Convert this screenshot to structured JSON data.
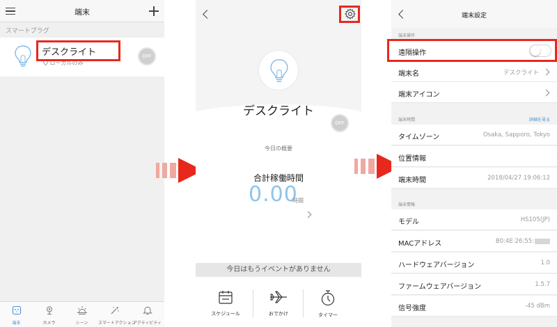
{
  "panel1": {
    "title": "端末",
    "section": "スマートプラグ",
    "device": {
      "name": "デスクライト",
      "subtitle": "ローカルのみ",
      "toggle": "OFF"
    },
    "tabs": [
      {
        "label": "端末",
        "icon": "plug-icon",
        "active": true
      },
      {
        "label": "カメラ",
        "icon": "camera-icon",
        "active": false
      },
      {
        "label": "シーン",
        "icon": "sunrise-icon",
        "active": false
      },
      {
        "label": "スマートアクション",
        "icon": "magic-wand-icon",
        "active": false
      },
      {
        "label": "アクティビティ",
        "icon": "bell-icon",
        "active": false
      }
    ]
  },
  "panel2": {
    "device_name": "デスクライト",
    "toggle": "OFF",
    "summary_label": "今日の概要",
    "total_label": "合計稼働時間",
    "total_value": "0.00",
    "total_unit": "時間",
    "no_events": "今日はもうイベントがありません",
    "actions": [
      {
        "label": "スケジュール",
        "icon": "calendar-icon"
      },
      {
        "label": "おでかけ",
        "icon": "airplane-icon"
      },
      {
        "label": "タイマー",
        "icon": "stopwatch-icon"
      }
    ]
  },
  "panel3": {
    "title": "端末設定",
    "sections": [
      {
        "header": "端末操作"
      },
      {
        "header": "端末時間",
        "link": "詳細を見る"
      },
      {
        "header": "端末情報"
      }
    ],
    "rows": {
      "remote": {
        "label": "遠隔操作",
        "toggle_on": false
      },
      "name": {
        "label": "端末名",
        "value": "デスクライト"
      },
      "icon": {
        "label": "端末アイコン"
      },
      "timezone": {
        "label": "タイムゾーン",
        "value": "Osaka, Sapporo, Tokyo"
      },
      "location": {
        "label": "位置情報"
      },
      "time": {
        "label": "端末時間",
        "value": "2018/04/27 19:06:12"
      },
      "model": {
        "label": "モデル",
        "value": "HS105(JP)"
      },
      "mac": {
        "label": "MACアドレス",
        "value": "B0:4E:26:55:"
      },
      "hw": {
        "label": "ハードウェアバージョン",
        "value": "1.0"
      },
      "fw": {
        "label": "ファームウェアバージョン",
        "value": "1.5.7"
      },
      "signal": {
        "label": "信号強度",
        "value": "-45 dBm"
      }
    }
  },
  "colors": {
    "highlight": "#e8271d",
    "accent": "#4a8fd4",
    "arrow": "#e8271d",
    "arrow_stripe": "#f0a8a0",
    "number": "#8ec5ec"
  }
}
